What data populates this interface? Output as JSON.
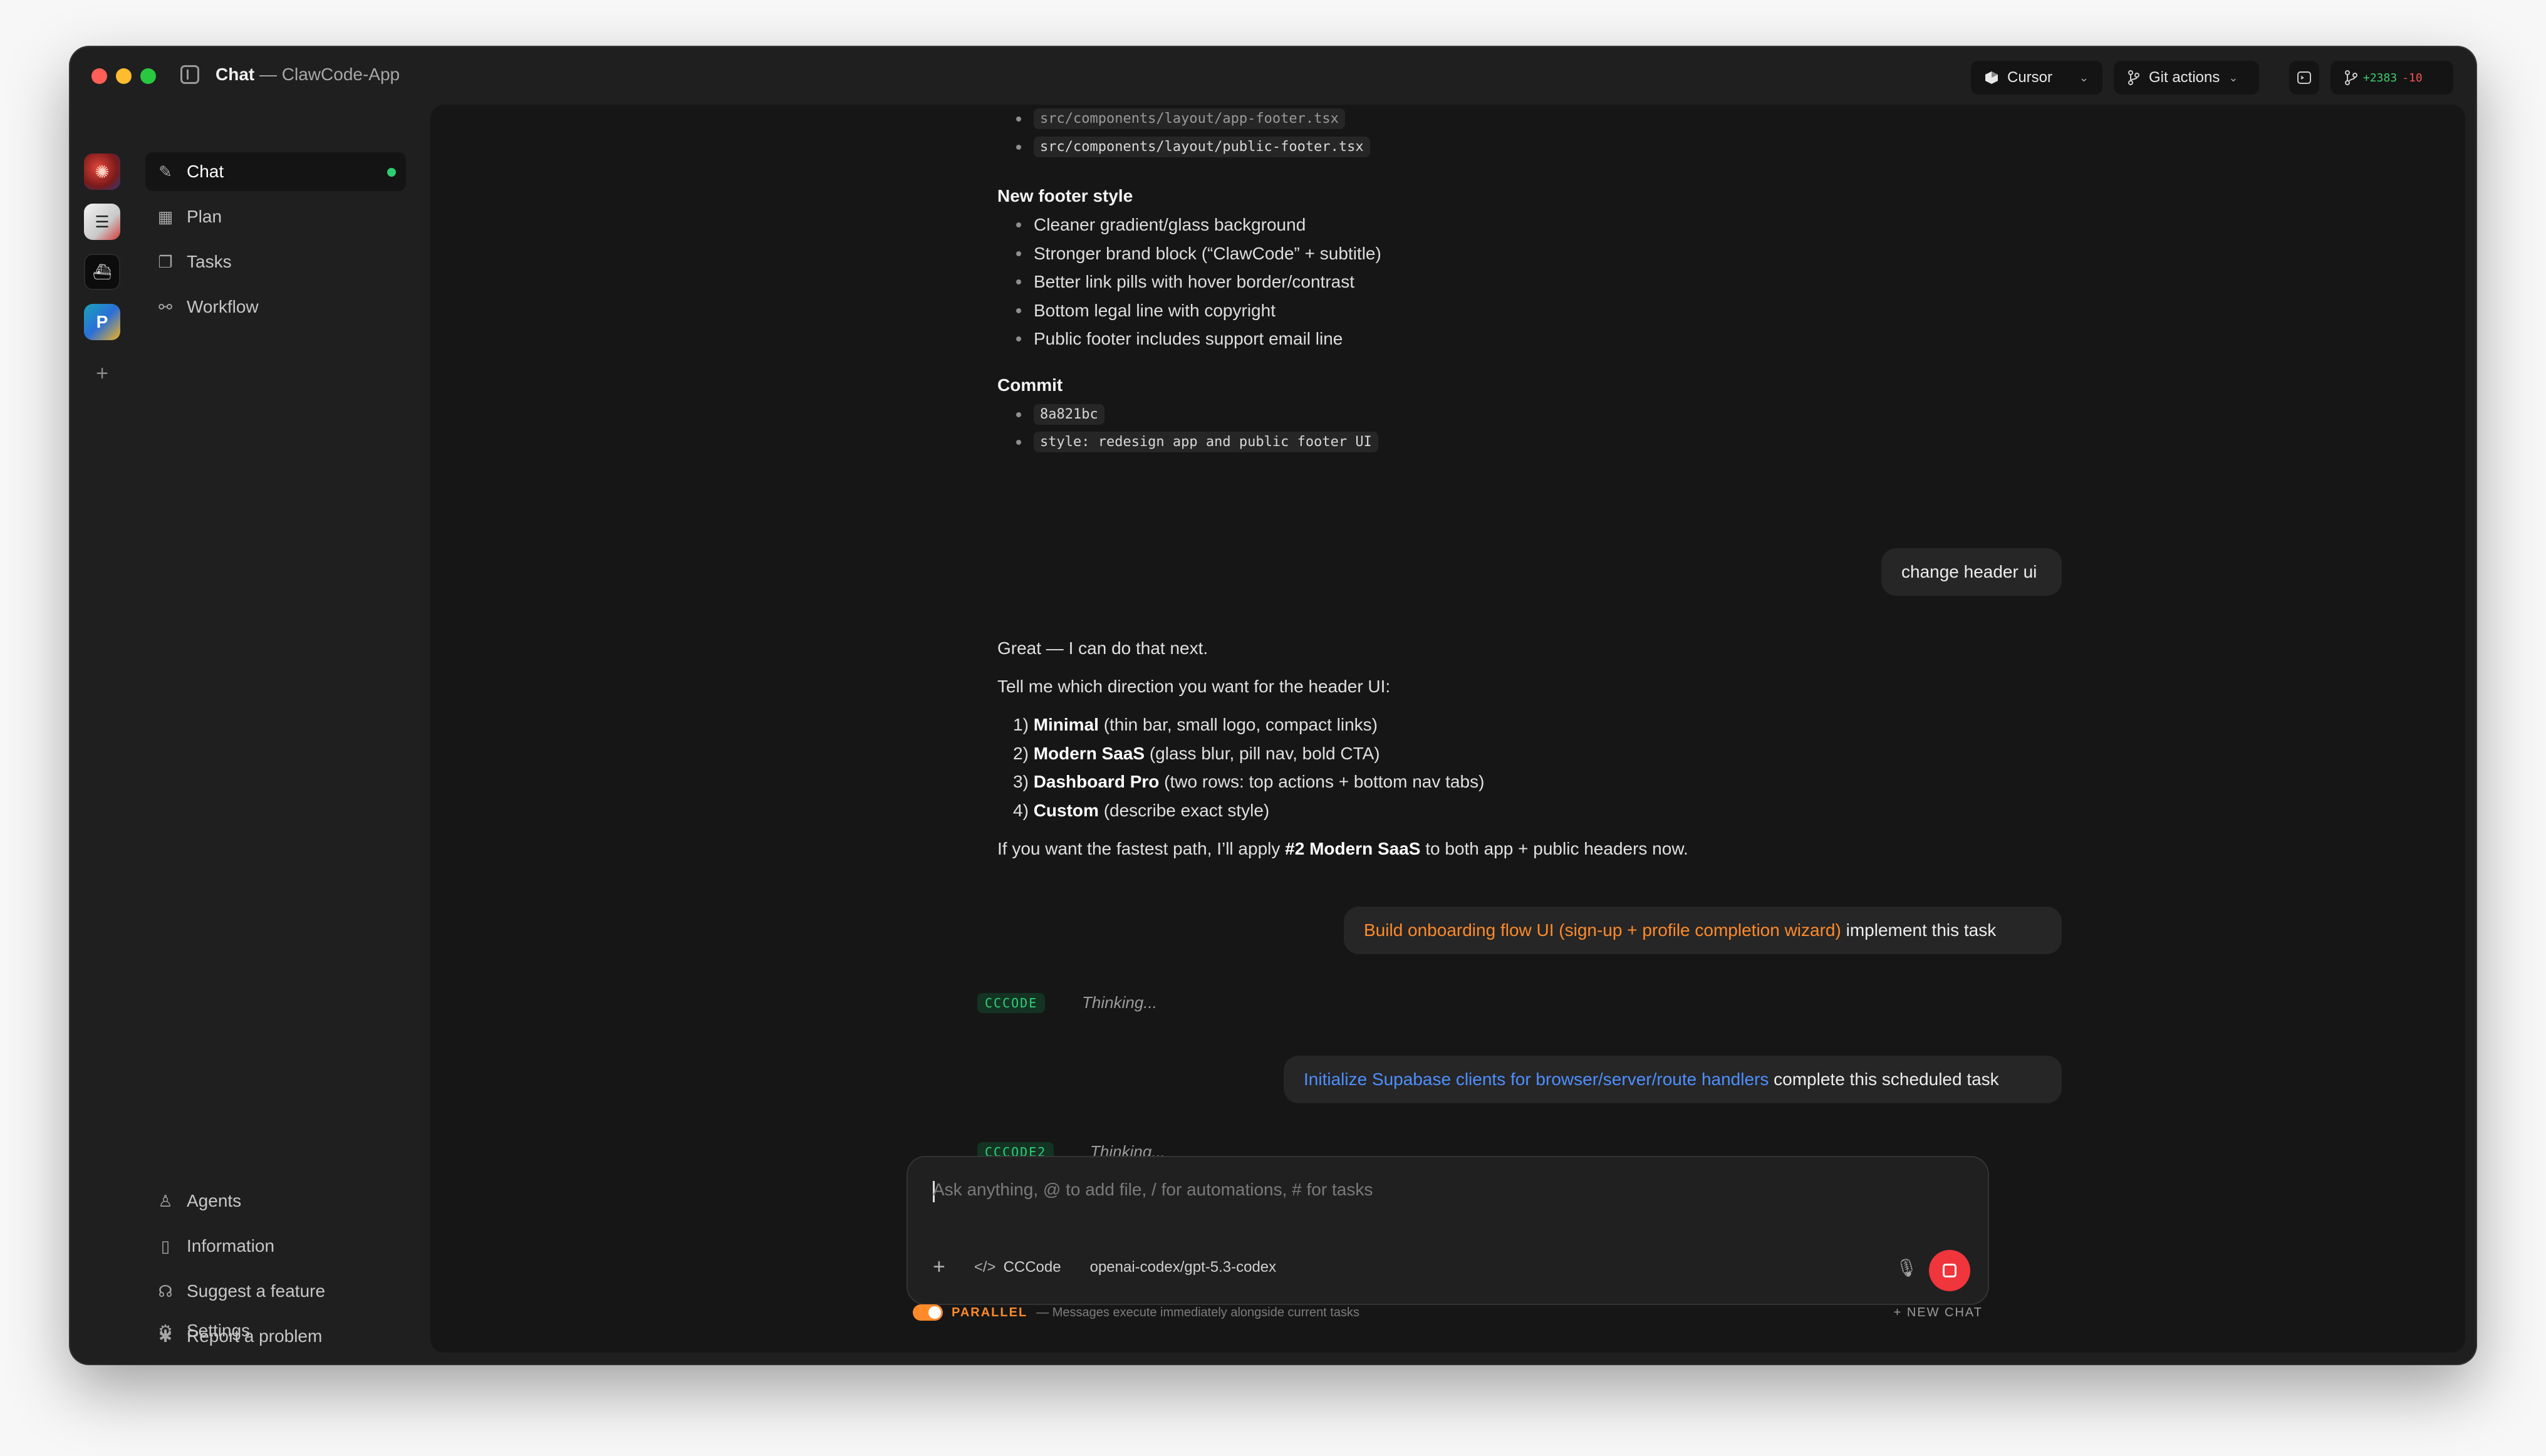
{
  "window": {
    "title": "Chat",
    "subtitle": "— ClawCode-App"
  },
  "toolbar": {
    "cursor_label": "Cursor",
    "git_actions_label": "Git actions",
    "diff_added": "+2383",
    "diff_removed": "-10"
  },
  "rail": {
    "workspaces": [
      "workspace-red",
      "workspace-notes",
      "workspace-dark",
      "workspace-parrot"
    ],
    "add_icon": "+"
  },
  "nav": {
    "top": [
      {
        "label": "Chat",
        "icon": "edit-icon"
      },
      {
        "label": "Plan",
        "icon": "calendar-icon"
      },
      {
        "label": "Tasks",
        "icon": "tasks-icon"
      },
      {
        "label": "Workflow",
        "icon": "workflow-icon"
      }
    ],
    "bottom": [
      {
        "label": "Agents",
        "icon": "agent-icon"
      },
      {
        "label": "Information",
        "icon": "info-icon"
      },
      {
        "label": "Suggest a feature",
        "icon": "lightbulb-icon"
      },
      {
        "label": "Report a problem",
        "icon": "bug-icon"
      },
      {
        "label": "Settings",
        "icon": "gear-icon"
      }
    ]
  },
  "chat": {
    "files": [
      "src/components/layout/app-footer.tsx",
      "src/components/layout/public-footer.tsx"
    ],
    "footer_heading": "New footer style",
    "footer_bullets": [
      "Cleaner gradient/glass background",
      "Stronger brand block (“ClawCode” + subtitle)",
      "Better link pills with hover border/contrast",
      "Bottom legal line with copyright",
      "Public footer includes support email line"
    ],
    "commit_heading": "Commit",
    "commit_hash": "8a821bc",
    "commit_message": "style: redesign app and public footer UI",
    "user_msg_1": "change header ui",
    "reply_intro": "Great — I can do that next.",
    "reply_question": "Tell me which direction you want for the header UI:",
    "options": [
      {
        "num": "1)",
        "name": "Minimal",
        "desc": "(thin bar, small logo, compact links)"
      },
      {
        "num": "2)",
        "name": "Modern SaaS",
        "desc": "(glass blur, pill nav, bold CTA)"
      },
      {
        "num": "3)",
        "name": "Dashboard Pro",
        "desc": "(two rows: top actions + bottom nav tabs)"
      },
      {
        "num": "4)",
        "name": "Custom",
        "desc": "(describe exact style)"
      }
    ],
    "reply_end_pre": "If you want the fastest path, I’ll apply",
    "reply_end_bold": "#2 Modern SaaS",
    "reply_end_post": "to both app + public headers now.",
    "task_msg_1_link": "Build onboarding flow UI (sign-up + profile completion wizard)",
    "task_msg_1_text": "implement this task",
    "agent_1": "CCCODE",
    "thinking_1": "Thinking...",
    "task_msg_2_link": "Initialize Supabase clients for browser/server/route handlers",
    "task_msg_2_text": "complete this scheduled task",
    "agent_2": "CCCODE2",
    "thinking_2": "Thinking..."
  },
  "composer": {
    "placeholder": "Ask anything, @ to add file, / for automations, # for tasks",
    "agent_label": "CCCode",
    "model_label": "openai-codex/gpt-5.3-codex"
  },
  "footer": {
    "parallel_label": "PARALLEL",
    "parallel_desc": "— Messages execute immediately alongside current tasks",
    "new_chat_label": "+ NEW CHAT"
  },
  "colors": {
    "accent_orange": "#ff8a2a",
    "accent_blue": "#4e8fff",
    "agent_green": "#2fd07a",
    "stop_red": "#f0353c"
  }
}
